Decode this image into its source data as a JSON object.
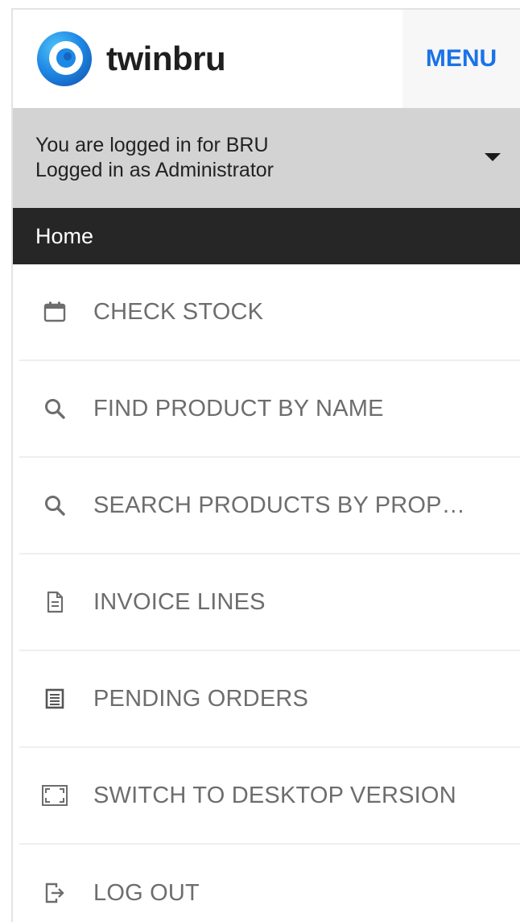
{
  "header": {
    "brand": "twinbru",
    "menu_label": "MENU",
    "logo_icon": "twinbru-logo",
    "colors": {
      "accent": "#1a73e8",
      "logo_outer": "#1e88e5",
      "logo_inner": "#ffffff"
    }
  },
  "user_bar": {
    "line1": "You are logged in for BRU",
    "line2": "Logged in as Administrator",
    "dropdown_icon": "caret-down-icon"
  },
  "section": {
    "title": "Home"
  },
  "menu": {
    "items": [
      {
        "label": "CHECK STOCK",
        "icon": "calendar-icon"
      },
      {
        "label": "FIND PRODUCT BY NAME",
        "icon": "search-icon"
      },
      {
        "label": "SEARCH PRODUCTS BY PROP…",
        "icon": "search-icon"
      },
      {
        "label": "INVOICE LINES",
        "icon": "document-icon"
      },
      {
        "label": "PENDING ORDERS",
        "icon": "list-icon"
      },
      {
        "label": "SWITCH TO DESKTOP VERSION",
        "icon": "fullscreen-icon"
      },
      {
        "label": "LOG OUT",
        "icon": "logout-icon"
      }
    ]
  }
}
